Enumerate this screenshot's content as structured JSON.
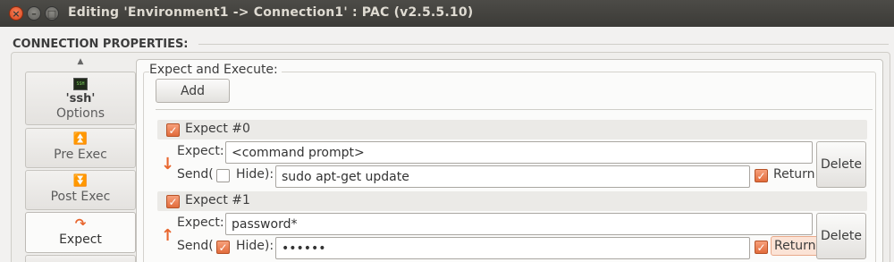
{
  "window": {
    "title": "Editing 'Environment1 -> Connection1' : PAC (v2.5.5.10)",
    "close_glyph": "×",
    "minimize_glyph": "–",
    "maximize_glyph": "□"
  },
  "section": {
    "title": "CONNECTION PROPERTIES:"
  },
  "tabs": {
    "scroll_up_glyph": "▲",
    "items": [
      {
        "icon": "ssh-terminal-icon",
        "badge": "SSH",
        "name": "'ssh'",
        "label": "Options",
        "active": false
      },
      {
        "icon": "pre-exec-icon",
        "glyph": "⏫",
        "label": "Pre Exec",
        "active": false
      },
      {
        "icon": "post-exec-icon",
        "glyph": "⏬",
        "label": "Post Exec",
        "active": false
      },
      {
        "icon": "expect-icon",
        "glyph": "↷",
        "label": "Expect",
        "active": true
      }
    ]
  },
  "expect_panel": {
    "title": "Expect and Execute:",
    "add_label": "Add",
    "expect_label": "Expect:",
    "send_label": "Send(",
    "hide_label": "Hide):",
    "return_label": "Return",
    "delete_label": "Delete",
    "items": [
      {
        "header": "Expect #0",
        "enabled": true,
        "arrow_glyph": "↓",
        "expect_value": "<command prompt>",
        "hide": false,
        "send_value": "sudo apt-get update",
        "return": true
      },
      {
        "header": "Expect #1",
        "enabled": true,
        "arrow_glyph": "↑",
        "expect_value": "password*",
        "hide": true,
        "send_value": "••••••",
        "return": true
      }
    ]
  },
  "colors": {
    "accent": "#e26c3c",
    "titlebar": "#3c3b37",
    "window_bg": "#f2f1f0"
  }
}
